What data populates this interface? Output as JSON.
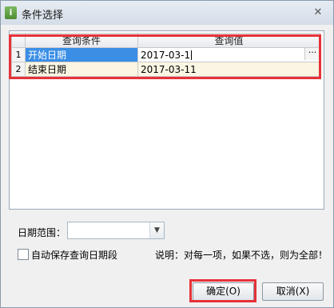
{
  "window": {
    "title": "条件选择",
    "close_glyph": "✕",
    "app_icon_glyph": "i"
  },
  "grid": {
    "columns": [
      "查询条件",
      "查询值"
    ],
    "rows": [
      {
        "num": "1",
        "condition": "开始日期",
        "value": "2017-03-1"
      },
      {
        "num": "2",
        "condition": "结束日期",
        "value": "2017-03-11"
      }
    ],
    "ellipsis": "···"
  },
  "date_range": {
    "label": "日期范围：",
    "value": "",
    "arrow_glyph": "▼"
  },
  "autosave": {
    "label": "自动保存查询日期段",
    "checked": false
  },
  "note": "说明：对每一项，如果不选，则为全部！",
  "buttons": {
    "ok": "确定(O)",
    "cancel": "取消(X)"
  },
  "colors": {
    "highlight": "#e63238",
    "selection": "#3a8ee6",
    "row_cream": "#fbf5e3"
  }
}
